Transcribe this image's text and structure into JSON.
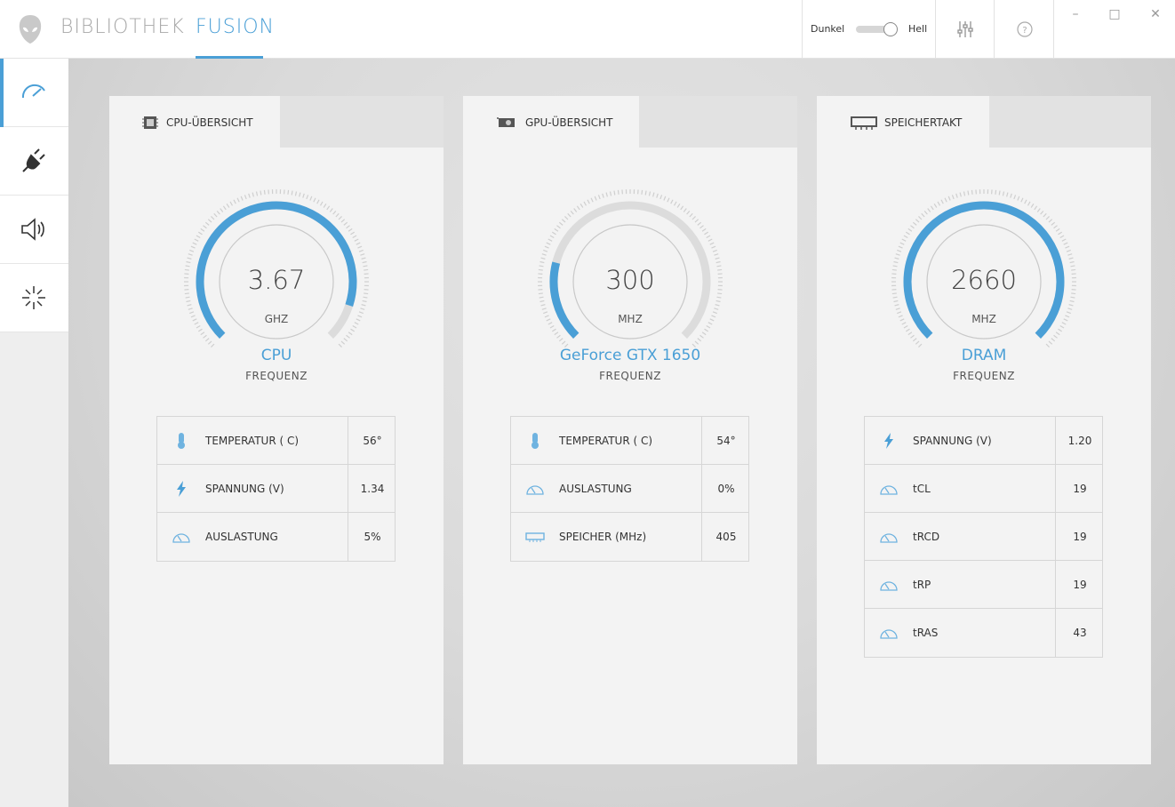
{
  "header": {
    "tabs": [
      {
        "label": "BIBLIOTHEK",
        "active": false
      },
      {
        "label": "FUSION",
        "active": true
      }
    ],
    "theme_toggle": {
      "left_label": "Dunkel",
      "right_label": "Hell",
      "state": "Hell"
    },
    "icons": [
      "settings-sliders-icon",
      "help-icon"
    ],
    "window_controls": [
      "minimize",
      "maximize",
      "close"
    ]
  },
  "sidebar": {
    "items": [
      {
        "icon": "performance-gauge-icon",
        "active": true
      },
      {
        "icon": "power-plug-icon",
        "active": false
      },
      {
        "icon": "speaker-icon",
        "active": false
      },
      {
        "icon": "lighting-icon",
        "active": false
      }
    ]
  },
  "colors": {
    "accent": "#4a9fd6",
    "gauge_track": "#dcdcdc"
  },
  "panels": [
    {
      "tab_label": "CPU-ÜBERSICHT",
      "tab_icon": "cpu-chip-icon",
      "gauge": {
        "value": "3.67",
        "unit": "GHZ",
        "name": "CPU",
        "subtitle": "FREQUENZ",
        "fill_fraction": 0.9
      },
      "stats": [
        {
          "icon": "thermometer-icon",
          "label": "TEMPERATUR ( C)",
          "value": "56°"
        },
        {
          "icon": "lightning-icon",
          "label": "SPANNUNG (V)",
          "value": "1.34"
        },
        {
          "icon": "speedometer-icon",
          "label": "AUSLASTUNG",
          "value": "5%"
        }
      ]
    },
    {
      "tab_label": "GPU-ÜBERSICHT",
      "tab_icon": "graphics-card-icon",
      "gauge": {
        "value": "300",
        "unit": "MHZ",
        "name": "GeForce GTX 1650",
        "subtitle": "FREQUENZ",
        "fill_fraction": 0.22
      },
      "stats": [
        {
          "icon": "thermometer-icon",
          "label": "TEMPERATUR ( C)",
          "value": "54°"
        },
        {
          "icon": "speedometer-icon",
          "label": "AUSLASTUNG",
          "value": "0%"
        },
        {
          "icon": "memory-module-icon",
          "label": "SPEICHER (MHz)",
          "value": "405"
        }
      ]
    },
    {
      "tab_label": "SPEICHERTAKT",
      "tab_icon": "memory-module-icon",
      "gauge": {
        "value": "2660",
        "unit": "MHZ",
        "name": "DRAM",
        "subtitle": "FREQUENZ",
        "fill_fraction": 1.0
      },
      "stats": [
        {
          "icon": "lightning-icon",
          "label": "SPANNUNG (V)",
          "value": "1.20"
        },
        {
          "icon": "speedometer-icon",
          "label": "tCL",
          "value": "19"
        },
        {
          "icon": "speedometer-icon",
          "label": "tRCD",
          "value": "19"
        },
        {
          "icon": "speedometer-icon",
          "label": "tRP",
          "value": "19"
        },
        {
          "icon": "speedometer-icon",
          "label": "tRAS",
          "value": "43"
        }
      ]
    }
  ]
}
